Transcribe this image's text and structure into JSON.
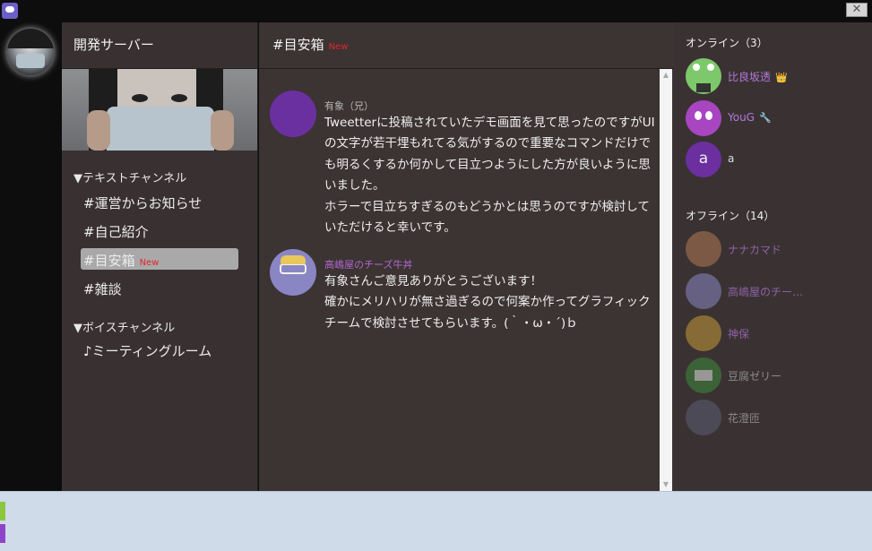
{
  "window": {
    "close_glyph": "✕"
  },
  "server": {
    "name": "開発サーバー"
  },
  "channels": {
    "text_category": "▼テキストチャンネル",
    "text": [
      {
        "label": "#運営からお知らせ",
        "badge": ""
      },
      {
        "label": "#自己紹介",
        "badge": ""
      },
      {
        "label": "#目安箱",
        "badge": "New"
      },
      {
        "label": "#雑談",
        "badge": ""
      }
    ],
    "voice_category": "▼ボイスチャンネル",
    "voice": [
      {
        "label": "♪ミーティングルーム"
      }
    ]
  },
  "main": {
    "title": "#目安箱",
    "title_badge": "New",
    "messages": [
      {
        "author": "有象（兄）",
        "author_color": "#b7b7b7",
        "avatar_color": "#6b30a0",
        "text": "Tweetterに投稿されていたデモ画面を見て思ったのですがUIの文字が若干埋もれてる気がするので重要なコマンドだけでも明るくするか何かして目立つようにした方が良いように思いました。\nホラーで目立ちすぎるのもどうかとは思うのですが検討していただけると幸いです。"
      },
      {
        "author": "高嶋屋のチーズ牛丼",
        "author_color": "#b06ad0",
        "avatar_color": "#8a86c4",
        "text": "有象さんご意見ありがとうございます！\n確かにメリハリが無さ過ぎるので何案か作ってグラフィックチームで検討させてもらいます。(｀・ω・´)ｂ"
      }
    ]
  },
  "members": {
    "online_label": "オンライン（3）",
    "online": [
      {
        "name": "比良坂透",
        "color": "#b277de",
        "badge": "👑",
        "badge_icon": "crown-icon",
        "avatar_color": "#7cc86b"
      },
      {
        "name": "YouG",
        "color": "#b277de",
        "badge": "🔧",
        "badge_icon": "wrench-icon",
        "avatar_color": "#a746c0"
      },
      {
        "name": "a",
        "color": "#dedede",
        "badge": "",
        "avatar_color": "#6b2fa0",
        "avatar_letter": "a"
      }
    ],
    "offline_label": "オフライン（14）",
    "offline": [
      {
        "name": "ナナカマド",
        "color": "#9c6abd",
        "avatar_color": "#b37a56"
      },
      {
        "name": "高嶋屋のチー…",
        "color": "#9c6abd",
        "avatar_color": "#8a86c4"
      },
      {
        "name": "神保",
        "color": "#9c6abd",
        "avatar_color": "#c79a3a"
      },
      {
        "name": "豆腐ゼリー",
        "color": "#9a9a9a",
        "avatar_color": "#3f8a3c"
      },
      {
        "name": "花澄匝",
        "color": "#9a9a9a",
        "avatar_color": "#5c5f78"
      }
    ]
  }
}
